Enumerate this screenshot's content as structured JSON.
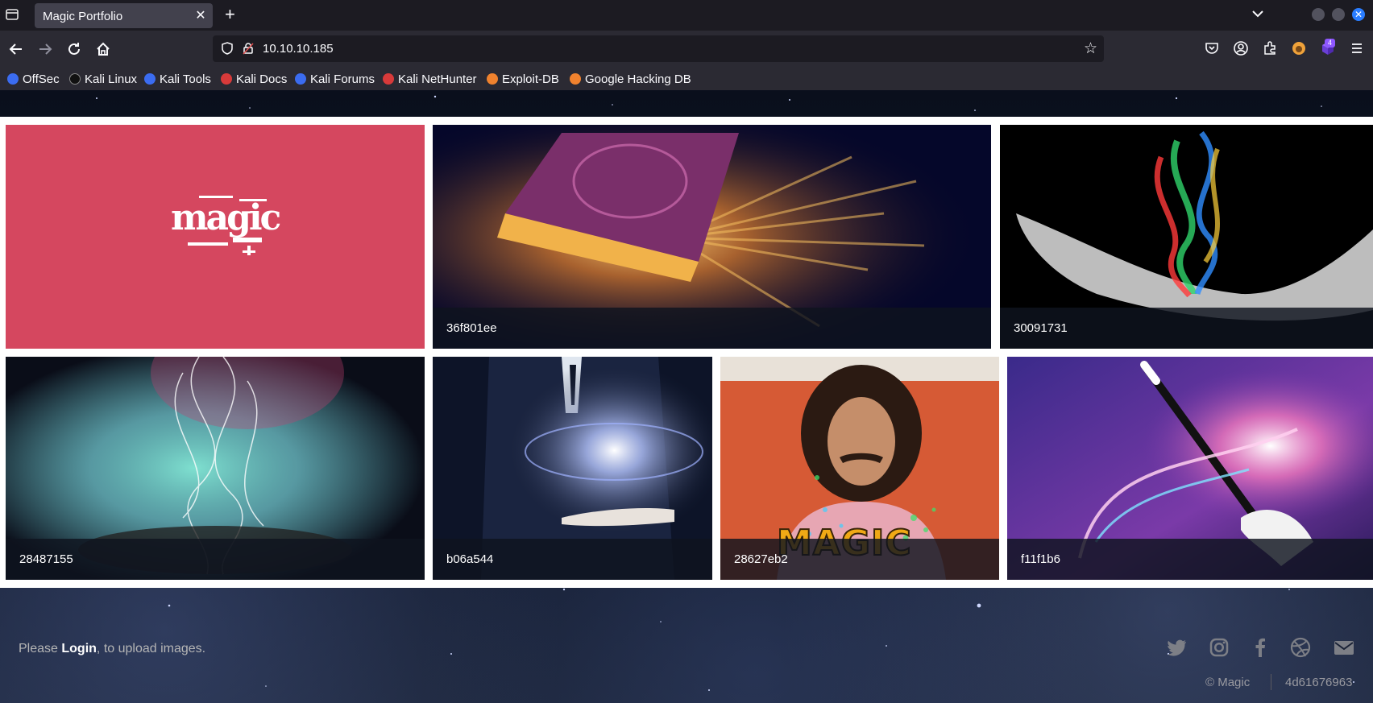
{
  "browser": {
    "tab_title": "Magic Portfolio",
    "url": "10.10.10.185",
    "extension_badge": "4",
    "bookmarks": [
      {
        "label": "OffSec",
        "color": "#3b6cf0"
      },
      {
        "label": "Kali Linux",
        "color": "#1f1f1f"
      },
      {
        "label": "Kali Tools",
        "color": "#3b6cf0"
      },
      {
        "label": "Kali Docs",
        "color": "#d83a3a"
      },
      {
        "label": "Kali Forums",
        "color": "#3b6cf0"
      },
      {
        "label": "Kali NetHunter",
        "color": "#d83a3a"
      },
      {
        "label": "Exploit-DB",
        "color": "#f0822e"
      },
      {
        "label": "Google Hacking DB",
        "color": "#f0822e"
      }
    ]
  },
  "gallery": {
    "logo_text": "magic",
    "tiles": [
      {
        "caption": "36f801ee"
      },
      {
        "caption": "30091731"
      },
      {
        "caption": "28487155"
      },
      {
        "caption": "b06a544"
      },
      {
        "caption": "28627eb2"
      },
      {
        "caption": "f11f1b6"
      }
    ],
    "magic_overlay_text": "MAGIC"
  },
  "footer": {
    "prefix": "Please ",
    "login_label": "Login",
    "suffix": ", to upload images.",
    "copyright": "© Magic",
    "hash": "4d61676963",
    "social_icons": [
      "twitter-icon",
      "instagram-icon",
      "facebook-icon",
      "dribbble-icon",
      "mail-icon"
    ]
  },
  "colors": {
    "logo_tile_bg": "#d5475f",
    "tab_bg": "#42414d",
    "urlbar_bg": "#1c1b22"
  }
}
